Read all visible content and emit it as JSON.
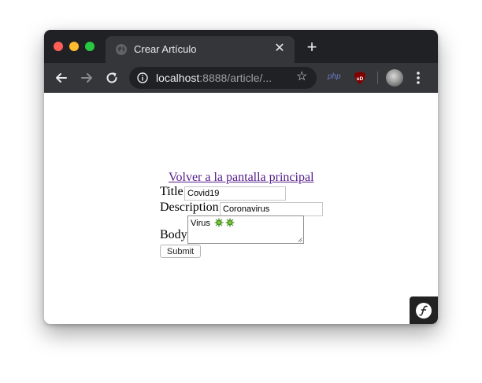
{
  "browser": {
    "tab": {
      "title": "Crear Artículo"
    },
    "address": {
      "host": "localhost",
      "rest": ":8888/article/..."
    },
    "extensions": {
      "php_label": "php",
      "ublock_label": "uD"
    },
    "colors": {
      "titlebar": "#202124",
      "toolbar": "#35363a",
      "link": "#551a8b"
    }
  },
  "page": {
    "back_link": "Volver a la pantalla principal",
    "form": {
      "title_label": "Title",
      "title_value": "Covid19",
      "description_label": "Description",
      "description_value": "Coronavirus",
      "body_label": "Body",
      "body_value": "Virus",
      "body_emoji": [
        "virus-icon",
        "virus-icon"
      ],
      "submit_label": "Submit"
    }
  },
  "icons": {
    "favicon": "globe-icon",
    "close": "close-icon",
    "new_tab": "plus-icon",
    "back": "arrow-left-icon",
    "forward": "arrow-right-icon",
    "reload": "reload-icon",
    "info": "info-icon",
    "bookmark": "star-icon",
    "menu": "kebab-menu-icon",
    "symfony": "symfony-logo-icon"
  }
}
